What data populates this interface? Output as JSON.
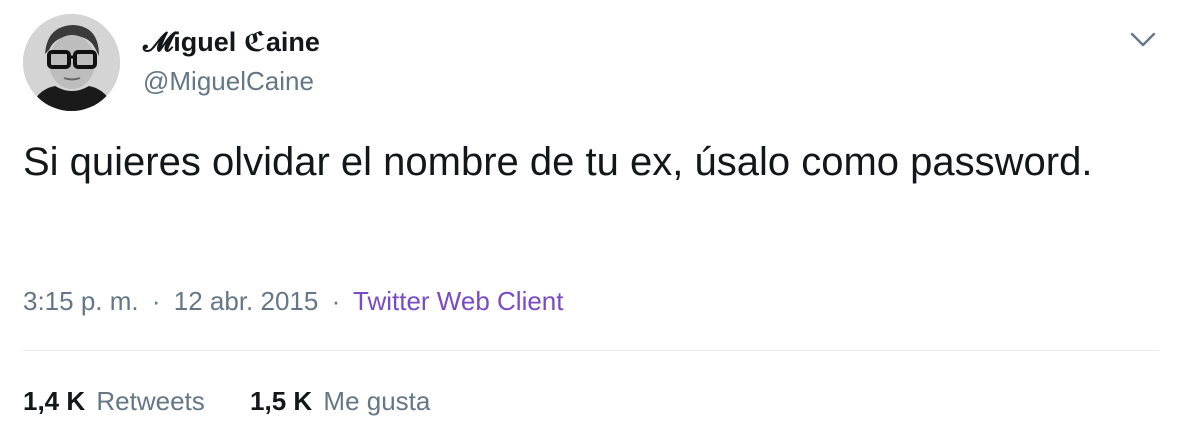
{
  "user": {
    "display_name": "𝓜iguel ℭaine",
    "handle": "@MiguelCaine",
    "avatar_icon": "user-avatar"
  },
  "tweet": {
    "text": "Si quieres olvidar el nombre de tu ex, úsalo como password.",
    "time": "3:15 p. m.",
    "separator": "·",
    "date": "12 abr. 2015",
    "client": "Twitter Web Client"
  },
  "stats": {
    "retweets_count": "1,4 K",
    "retweets_label": "Retweets",
    "likes_count": "1,5 K",
    "likes_label": "Me gusta"
  },
  "colors": {
    "text": "#14171a",
    "secondary": "#657786",
    "client_link": "#794bc4",
    "divider": "#e6ecf0"
  },
  "icons": {
    "menu": "chevron-down-icon"
  }
}
